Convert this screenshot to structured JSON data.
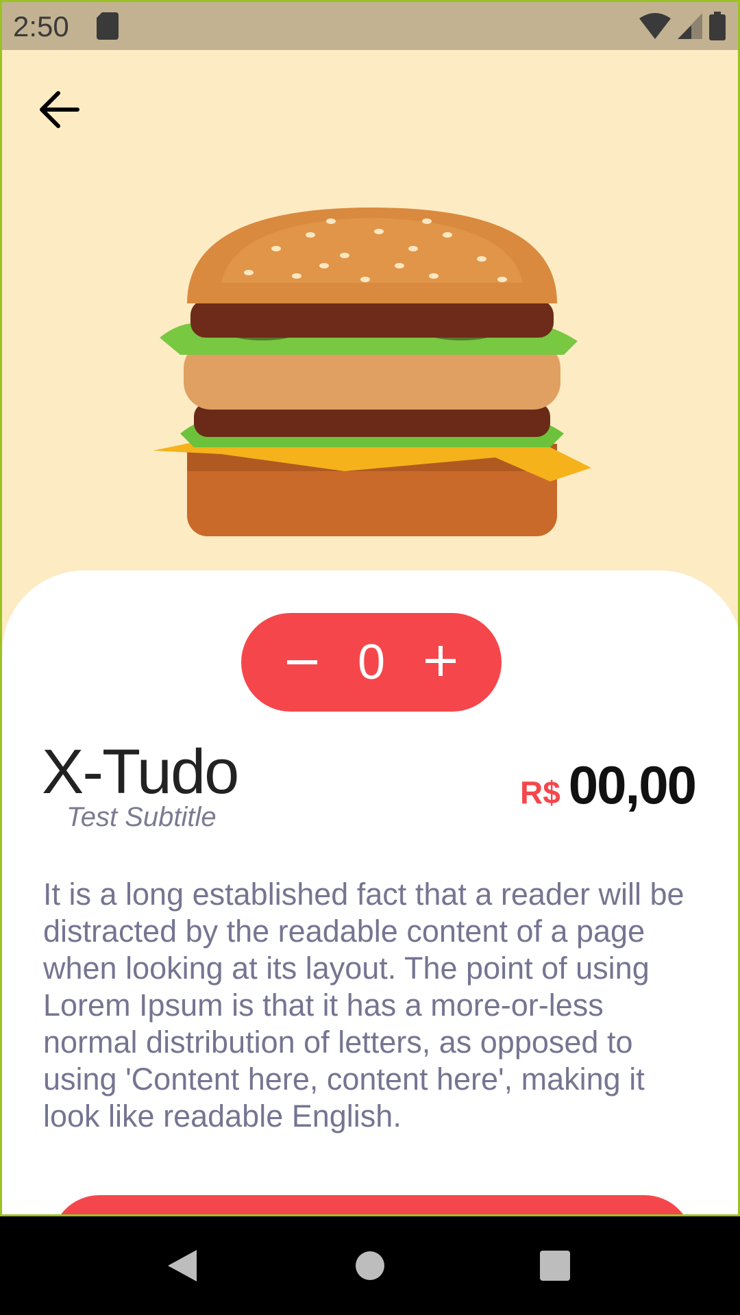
{
  "status_bar": {
    "time": "2:50"
  },
  "product": {
    "title": "X-Tudo",
    "subtitle": "Test Subtitle",
    "currency": "R$",
    "price": "00,00",
    "quantity": "0",
    "description": "It is a long established fact that a reader will be distracted by the readable content of a page when looking at its layout. The point of using Lorem Ipsum is that it has a more-or-less normal distribution of letters, as opposed to using 'Content here, content here', making it look like readable English."
  },
  "icons": [
    "sd-card-icon",
    "wifi-icon",
    "cellular-signal-icon",
    "battery-icon",
    "back-arrow-icon",
    "minus-icon",
    "plus-icon",
    "nav-back-icon",
    "nav-home-icon",
    "nav-recents-icon"
  ],
  "colors": {
    "accent": "#f5474b",
    "hero_background": "#fdebc4",
    "status_bar": "#c2b291",
    "text_muted": "#757592"
  }
}
